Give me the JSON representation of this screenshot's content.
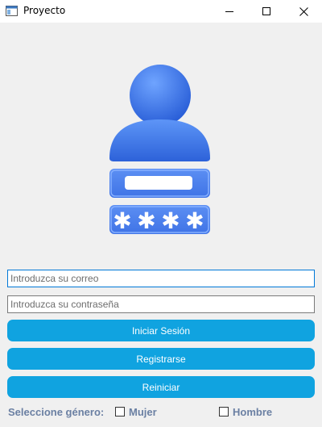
{
  "window": {
    "title": "Proyecto",
    "icons": {
      "app": "window-icon",
      "minimize": "minimize-icon",
      "maximize": "maximize-icon",
      "close": "close-icon"
    }
  },
  "hero": {
    "icon": "user-login-illustration",
    "accent": "#3d7cf0"
  },
  "form": {
    "email": {
      "placeholder": "Introduzca su correo",
      "value": ""
    },
    "password": {
      "placeholder": "Introduzca su contraseña",
      "value": ""
    }
  },
  "buttons": {
    "login": "Iniciar Sesión",
    "register": "Registrarse",
    "reset": "Reiniciar",
    "color": "#10a3e0"
  },
  "gender": {
    "label": "Seleccione género:",
    "options": [
      {
        "label": "Mujer",
        "checked": false
      },
      {
        "label": "Hombre",
        "checked": false
      }
    ]
  }
}
